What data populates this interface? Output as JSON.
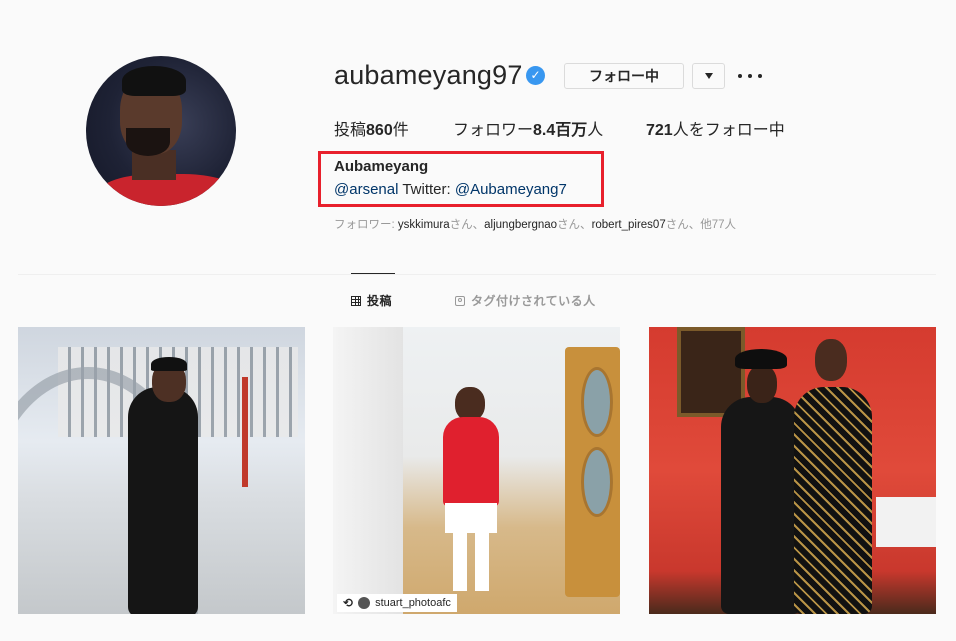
{
  "profile": {
    "username": "aubameyang97",
    "verified_mark": "✓",
    "follow_button_label": "フォロー中",
    "stats": {
      "posts_prefix": "投稿",
      "posts_count": "860",
      "posts_suffix": "件",
      "followers_prefix": "フォロワー",
      "followers_count": "8.4百万",
      "followers_suffix": "人",
      "following_count": "721",
      "following_suffix": "人をフォロー中"
    },
    "bio": {
      "name": "Aubameyang",
      "link_arsenal": "@arsenal",
      "twitter_label": "Twitter:",
      "link_twitter": "@Aubameyang7"
    },
    "followed_by": {
      "prefix": "フォロワー: ",
      "user1": "yskkimura",
      "sep1": "さん、",
      "user2": "aljungbergnao",
      "sep2": "さん、",
      "user3": "robert_pires07",
      "suffix": "さん、他77人"
    }
  },
  "tabs": [
    {
      "label": "投稿",
      "icon": "grid-icon",
      "active": true
    },
    {
      "label": "タグ付けされている人",
      "icon": "tag-icon",
      "active": false
    }
  ],
  "posts": [
    {
      "description": "photo-1"
    },
    {
      "description": "photo-2",
      "credit": "stuart_photoafc"
    },
    {
      "description": "photo-3"
    }
  ],
  "colors": {
    "accent_blue": "#3897f0",
    "highlight_red": "#e8202c",
    "link": "#003569"
  }
}
